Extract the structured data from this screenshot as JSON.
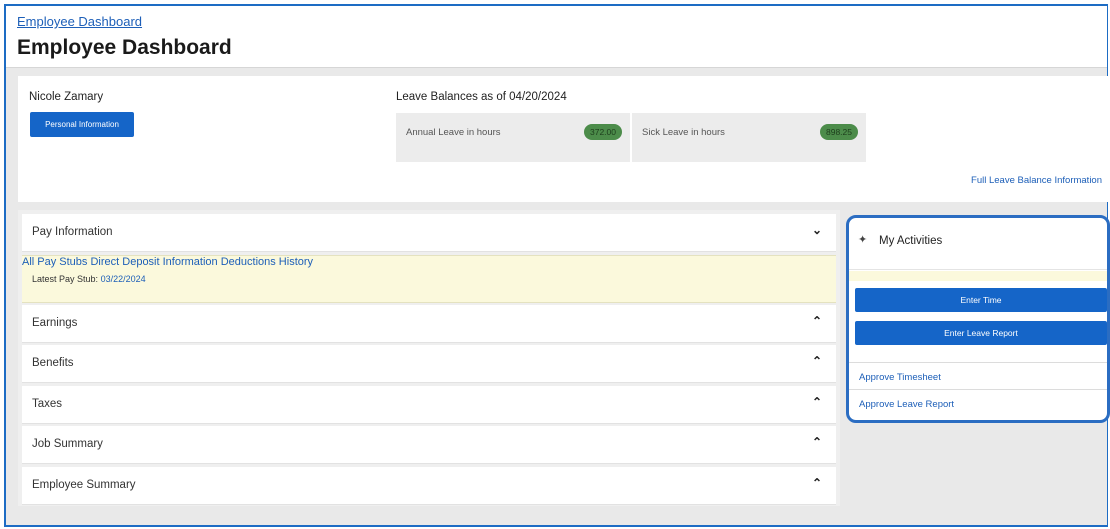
{
  "breadcrumb": "Employee Dashboard",
  "page_title": "Employee Dashboard",
  "employee": {
    "name": "Nicole Zamary",
    "personal_info_button": "Personal Information"
  },
  "leave": {
    "title": "Leave Balances as of 04/20/2024",
    "annual_label": "Annual Leave in hours",
    "annual_value": "372.00",
    "sick_label": "Sick Leave in hours",
    "sick_value": "898.25",
    "full_link": "Full Leave Balance Information",
    "badge_color": "#4c8c4a"
  },
  "pay": {
    "header": "Pay Information",
    "latest_stub_label": "Latest Pay Stub:",
    "latest_stub_date": "03/22/2024",
    "all_stubs": "All Pay Stubs",
    "direct_deposit": "Direct Deposit Information",
    "deductions": "Deductions History"
  },
  "sections": {
    "earnings": "Earnings",
    "benefits": "Benefits",
    "taxes": "Taxes",
    "job_summary": "Job Summary",
    "employee_summary": "Employee Summary"
  },
  "activities": {
    "title": "My Activities",
    "enter_time": "Enter Time",
    "enter_leave": "Enter Leave Report",
    "approve_timesheet": "Approve Timesheet",
    "approve_leave": "Approve Leave Report"
  },
  "icons": {
    "expanded": "chevron-down-icon",
    "collapsed": "chevron-up-icon",
    "activities": "wand-icon"
  },
  "colors": {
    "primary": "#1565c8",
    "link": "#1d5fb8",
    "highlight": "#fbf9dc"
  }
}
